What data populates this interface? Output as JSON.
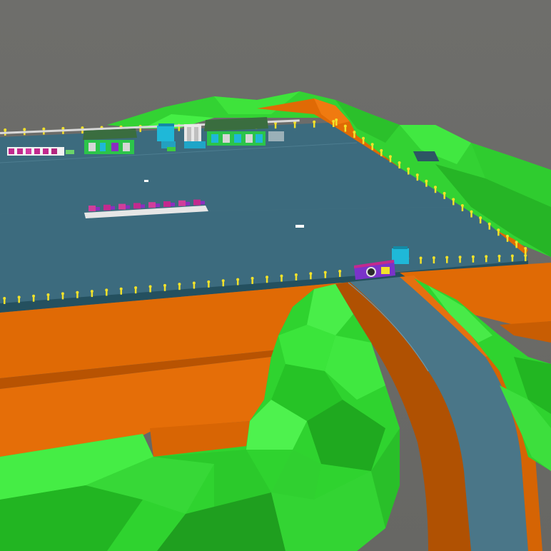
{
  "viewport": {
    "kind": "3D site model render",
    "colors": {
      "sky": "#6b6b69",
      "terrain_green": "#2fd32f",
      "terrain_green_light": "#4ff04a",
      "terrain_green_dark": "#1fa51f",
      "embankment_orange": "#e06a05",
      "embankment_orange_dark": "#a84e02",
      "platform_blue": "#3c6b7e",
      "platform_edge": "#24505f",
      "road_blue": "#4a7688",
      "railing_yellow": "#f2e22a",
      "building_roof": "#3a6d3f",
      "building_cyan": "#1fb8d8",
      "equipment_magenta": "#c22a8e",
      "equipment_purple": "#7a33c9"
    }
  },
  "scene": {
    "terrain": {
      "icon": "hill-terrain"
    },
    "platform": {
      "icon": "flat-pad"
    },
    "buildings": [
      {
        "name": "green-roof-shed",
        "icon": "shed-icon"
      },
      {
        "name": "cyan-hut",
        "icon": "hut-icon"
      },
      {
        "name": "white-tank-block",
        "icon": "tank-icon"
      },
      {
        "name": "long-green-roof-shed",
        "icon": "shed-icon"
      },
      {
        "name": "gate-cabin",
        "icon": "hut-icon"
      }
    ],
    "equipment": [
      {
        "name": "pump-row-left",
        "icon": "pump-row-icon"
      },
      {
        "name": "pump-row-center",
        "icon": "pump-row-icon"
      },
      {
        "name": "gate-machinery",
        "icon": "gate-icon"
      }
    ],
    "road": {
      "icon": "road-icon"
    }
  }
}
